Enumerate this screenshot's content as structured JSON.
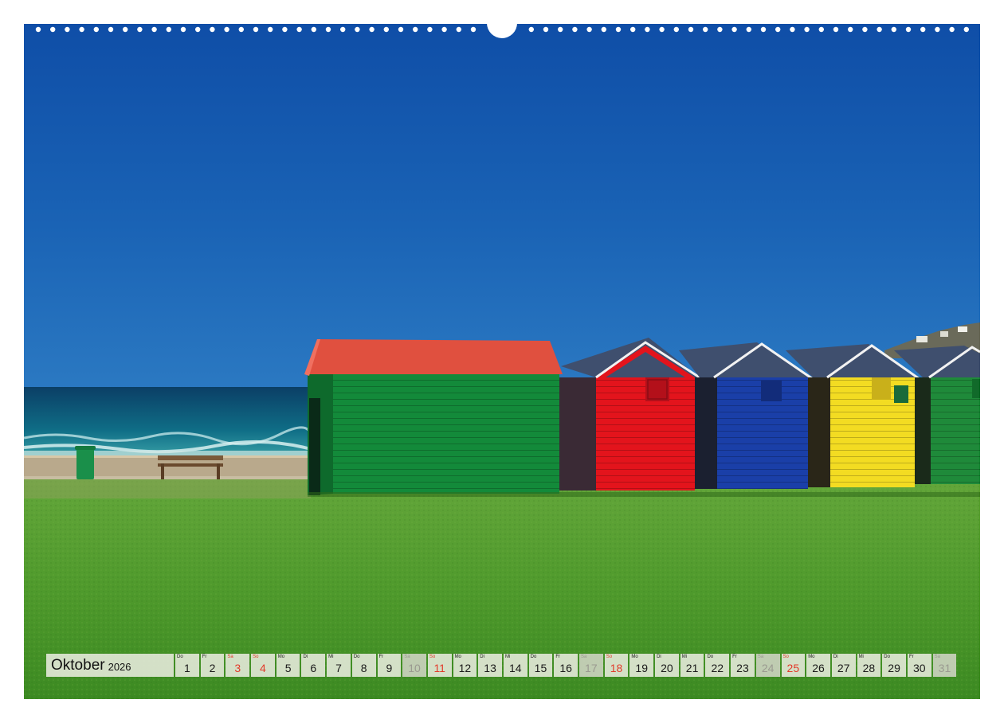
{
  "calendar": {
    "month": "Oktober",
    "year": "2026",
    "days": [
      {
        "wd": "Do",
        "num": "1",
        "type": "weekday"
      },
      {
        "wd": "Fr",
        "num": "2",
        "type": "weekday"
      },
      {
        "wd": "Sa",
        "num": "3",
        "type": "sun"
      },
      {
        "wd": "So",
        "num": "4",
        "type": "sun"
      },
      {
        "wd": "Mo",
        "num": "5",
        "type": "weekday"
      },
      {
        "wd": "Di",
        "num": "6",
        "type": "weekday"
      },
      {
        "wd": "Mi",
        "num": "7",
        "type": "weekday"
      },
      {
        "wd": "Do",
        "num": "8",
        "type": "weekday"
      },
      {
        "wd": "Fr",
        "num": "9",
        "type": "weekday"
      },
      {
        "wd": "Sa",
        "num": "10",
        "type": "sat"
      },
      {
        "wd": "So",
        "num": "11",
        "type": "sun"
      },
      {
        "wd": "Mo",
        "num": "12",
        "type": "weekday"
      },
      {
        "wd": "Di",
        "num": "13",
        "type": "weekday"
      },
      {
        "wd": "Mi",
        "num": "14",
        "type": "weekday"
      },
      {
        "wd": "Do",
        "num": "15",
        "type": "weekday"
      },
      {
        "wd": "Fr",
        "num": "16",
        "type": "weekday"
      },
      {
        "wd": "Sa",
        "num": "17",
        "type": "sat"
      },
      {
        "wd": "So",
        "num": "18",
        "type": "sun"
      },
      {
        "wd": "Mo",
        "num": "19",
        "type": "weekday"
      },
      {
        "wd": "Di",
        "num": "20",
        "type": "weekday"
      },
      {
        "wd": "Mi",
        "num": "21",
        "type": "weekday"
      },
      {
        "wd": "Do",
        "num": "22",
        "type": "weekday"
      },
      {
        "wd": "Fr",
        "num": "23",
        "type": "weekday"
      },
      {
        "wd": "Sa",
        "num": "24",
        "type": "sat"
      },
      {
        "wd": "So",
        "num": "25",
        "type": "sun"
      },
      {
        "wd": "Mo",
        "num": "26",
        "type": "weekday"
      },
      {
        "wd": "Di",
        "num": "27",
        "type": "weekday"
      },
      {
        "wd": "Mi",
        "num": "28",
        "type": "weekday"
      },
      {
        "wd": "Do",
        "num": "29",
        "type": "weekday"
      },
      {
        "wd": "Fr",
        "num": "30",
        "type": "weekday"
      },
      {
        "wd": "Sa",
        "num": "31",
        "type": "sat"
      }
    ]
  },
  "colors": {
    "sky": "#1a5eb0",
    "sea": "#0d4f6e",
    "grass": "#4f9a2c",
    "hut_green": "#138a3a",
    "hut_green_roof": "#e0503f",
    "hut_red": "#e3141c",
    "hut_blue": "#1a3fa8",
    "hut_yellow": "#f3dc22",
    "roof_slate": "#3f4f6e",
    "sunday_red": "#e23a2a"
  }
}
